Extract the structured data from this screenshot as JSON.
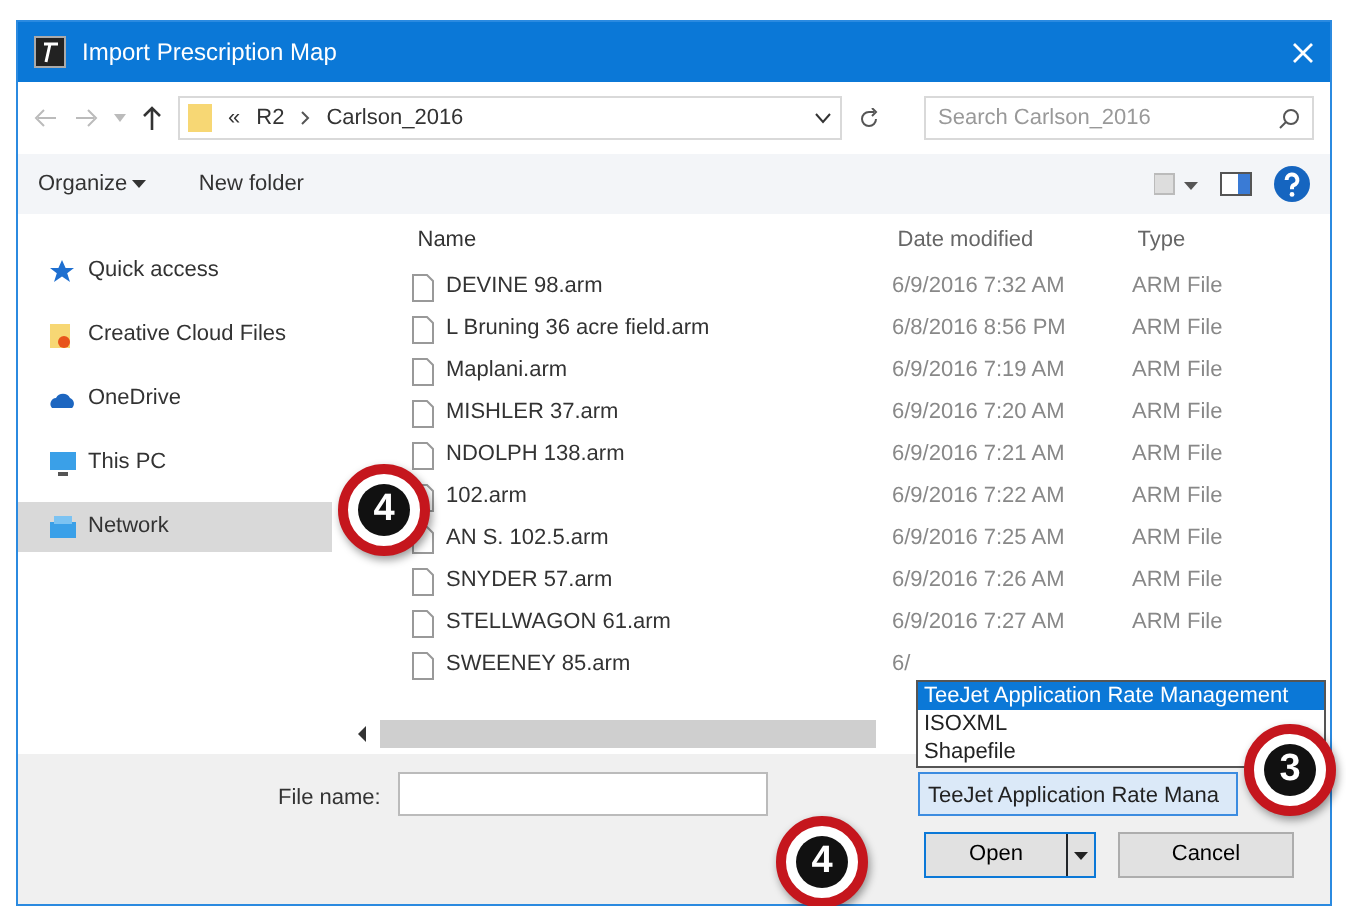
{
  "window": {
    "title": "Import Prescription Map"
  },
  "address_bar": {
    "overflow": "«",
    "crumbs": [
      "R2",
      "Carlson_2016"
    ]
  },
  "search": {
    "placeholder": "Search Carlson_2016"
  },
  "toolbar": {
    "buttons": [
      "Organize",
      "New folder"
    ]
  },
  "nav_pane": {
    "items": [
      {
        "label": "Quick access",
        "kind": "star",
        "selected": false
      },
      {
        "label": "Creative Cloud Files",
        "kind": "cloudfolder",
        "selected": false
      },
      {
        "label": "OneDrive",
        "kind": "cloud",
        "selected": false
      },
      {
        "label": "This PC",
        "kind": "pc",
        "selected": false
      },
      {
        "label": "Network",
        "kind": "network",
        "selected": true
      }
    ]
  },
  "table": {
    "columns": [
      "Name",
      "Date modified",
      "Type"
    ],
    "rows": [
      {
        "name": "DEVINE 98.arm",
        "date": "6/9/2016 7:32 AM",
        "type": "ARM File"
      },
      {
        "name": "L Bruning 36 acre field.arm",
        "date": "6/8/2016 8:56 PM",
        "type": "ARM File"
      },
      {
        "name": "Maplani.arm",
        "date": "6/9/2016 7:19 AM",
        "type": "ARM File"
      },
      {
        "name": "MISHLER 37.arm",
        "date": "6/9/2016 7:20 AM",
        "type": "ARM File"
      },
      {
        "name": "NDOLPH 138.arm",
        "date": "6/9/2016 7:21 AM",
        "type": "ARM File"
      },
      {
        "name": "102.arm",
        "date": "6/9/2016 7:22 AM",
        "type": "ARM File"
      },
      {
        "name": "AN S. 102.5.arm",
        "date": "6/9/2016 7:25 AM",
        "type": "ARM File"
      },
      {
        "name": "SNYDER 57.arm",
        "date": "6/9/2016 7:26 AM",
        "type": "ARM File"
      },
      {
        "name": "STELLWAGON 61.arm",
        "date": "6/9/2016 7:27 AM",
        "type": "ARM File"
      },
      {
        "name": "SWEENEY 85.arm",
        "date": "6/"
      }
    ]
  },
  "file_name": {
    "label": "File name:"
  },
  "file_type": {
    "value": "TeeJet Application Rate Mana",
    "options": [
      {
        "label": "TeeJet Application Rate Management",
        "selected": true
      },
      {
        "label": "ISOXML",
        "selected": false
      },
      {
        "label": "Shapefile",
        "selected": false
      }
    ]
  },
  "buttons": [
    {
      "label": "Open",
      "kind": "split"
    },
    {
      "label": "Cancel",
      "kind": "plain"
    }
  ],
  "callouts": [
    {
      "number": "4",
      "kind": "rows"
    },
    {
      "number": "3",
      "kind": "type"
    },
    {
      "number": "4",
      "kind": "open"
    }
  ]
}
